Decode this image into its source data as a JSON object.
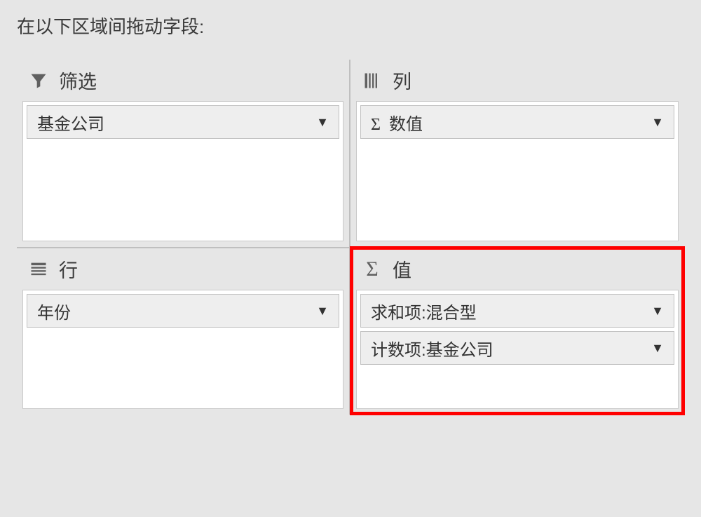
{
  "instruction": "在以下区域间拖动字段:",
  "areas": {
    "filter": {
      "label": "筛选",
      "items": [
        {
          "label": "基金公司",
          "prefix": ""
        }
      ]
    },
    "columns": {
      "label": "列",
      "items": [
        {
          "label": "数值",
          "prefix": "Σ "
        }
      ]
    },
    "rows": {
      "label": "行",
      "items": [
        {
          "label": "年份",
          "prefix": ""
        }
      ]
    },
    "values": {
      "label": "值",
      "prefix": "Σ",
      "items": [
        {
          "label": "求和项:混合型",
          "prefix": ""
        },
        {
          "label": "计数项:基金公司",
          "prefix": ""
        }
      ]
    }
  }
}
